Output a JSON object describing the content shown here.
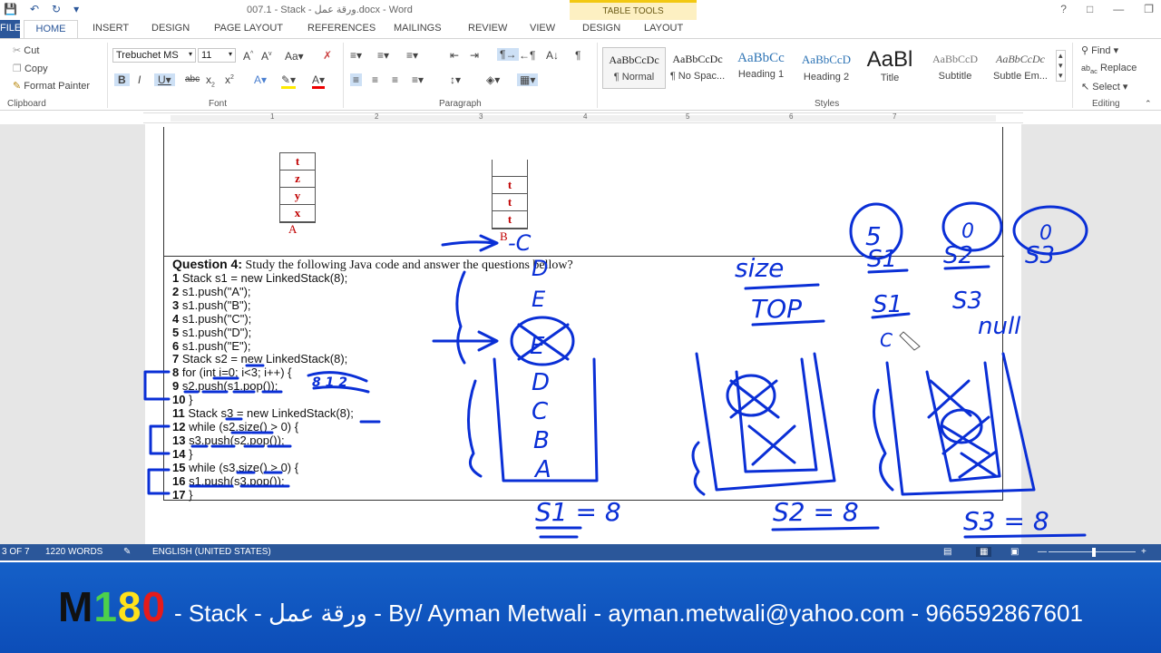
{
  "window": {
    "title": "007.1 - Stack - ورقة عمل.docx - Word",
    "context_group": "TABLE TOOLS"
  },
  "tabs": [
    "FILE",
    "HOME",
    "INSERT",
    "DESIGN",
    "PAGE LAYOUT",
    "REFERENCES",
    "MAILINGS",
    "REVIEW",
    "VIEW",
    "DESIGN",
    "LAYOUT"
  ],
  "ribbon": {
    "clipboard": {
      "label": "Clipboard",
      "cut": "Cut",
      "copy": "Copy",
      "format_painter": "Format Painter"
    },
    "font": {
      "label": "Font",
      "family": "Trebuchet MS",
      "size": "11"
    },
    "paragraph": {
      "label": "Paragraph"
    },
    "styles": {
      "label": "Styles",
      "items": [
        {
          "preview": "AaBbCcDc",
          "name": "¶ Normal"
        },
        {
          "preview": "AaBbCcDc",
          "name": "¶ No Spac..."
        },
        {
          "preview": "AaBbCc",
          "name": "Heading 1"
        },
        {
          "preview": "AaBbCcD",
          "name": "Heading 2"
        },
        {
          "preview": "AaBl",
          "name": "Title"
        },
        {
          "preview": "AaBbCcD",
          "name": "Subtitle"
        },
        {
          "preview": "AaBbCcDc",
          "name": "Subtle Em..."
        }
      ]
    },
    "editing": {
      "label": "Editing",
      "find": "Find",
      "replace": "Replace",
      "select": "Select"
    }
  },
  "ruler": [
    "1",
    "2",
    "3",
    "4",
    "5",
    "6",
    "7"
  ],
  "document": {
    "stack_a": {
      "cells": [
        "t",
        "z",
        "y",
        "x"
      ],
      "label": "A"
    },
    "stack_b": {
      "cells": [
        "",
        "t",
        "t",
        "t"
      ],
      "label": "B"
    },
    "question_title": "Question 4:",
    "question_text": " Study the following Java code and answer the questions bellow?",
    "code_lines": [
      {
        "n": "1",
        "t": " Stack s1 = new LinkedStack(8);"
      },
      {
        "n": "2",
        "t": " s1.push(\"A\");"
      },
      {
        "n": "3",
        "t": " s1.push(\"B\");"
      },
      {
        "n": "4",
        "t": " s1.push(\"C\");"
      },
      {
        "n": "5",
        "t": " s1.push(\"D\");"
      },
      {
        "n": "6",
        "t": " s1.push(\"E\");"
      },
      {
        "n": "7",
        "t": " Stack s2 = new LinkedStack(8);"
      },
      {
        "n": "8",
        "t": " for (int i=0; i<3; i++) {"
      },
      {
        "n": "9",
        "t": " s2.push(s1.pop());"
      },
      {
        "n": "10",
        "t": " }"
      },
      {
        "n": "11",
        "t": " Stack s3 = new LinkedStack(8);"
      },
      {
        "n": "12",
        "t": " while (s2.size() > 0) {"
      },
      {
        "n": "13",
        "t": " s3.push(s2.pop());"
      },
      {
        "n": "14",
        "t": " }"
      },
      {
        "n": "15",
        "t": " while (s3.size() > 0) {"
      },
      {
        "n": "16",
        "t": " s1.push(s3.pop());"
      },
      {
        "n": "17",
        "t": " }"
      }
    ]
  },
  "handwriting": {
    "column_b": [
      "-C",
      "D",
      "E"
    ],
    "s1_stack": [
      "E",
      "D",
      "C",
      "B",
      "A"
    ],
    "s1_eq": "S1 = 8",
    "s2_eq": "S2 = 8",
    "s3_eq": "S3 = 8",
    "size_label": "size",
    "top_label": "TOP",
    "circled": [
      "5",
      "0",
      "0"
    ],
    "row_s": [
      "S1",
      "S2",
      "S3"
    ],
    "row_top": [
      "S1",
      "S3"
    ],
    "null_text": "null",
    "c_letter": "C",
    "eq_small": "8 1 2"
  },
  "status": {
    "page": "3 OF 7",
    "words": "1220 WORDS",
    "language": "ENGLISH (UNITED STATES)"
  },
  "banner": {
    "logo_m": "M",
    "logo_1": "1",
    "logo_8": "8",
    "logo_0": "0",
    "text": "- Stack - ورقة عمل - By/ Ayman Metwali - ayman.metwali@yahoo.com - 966592867601"
  },
  "colors": {
    "accent": "#2b579a",
    "ink": "#0a2fd6",
    "stack_text": "#c00000",
    "banner": "#1560c8"
  }
}
